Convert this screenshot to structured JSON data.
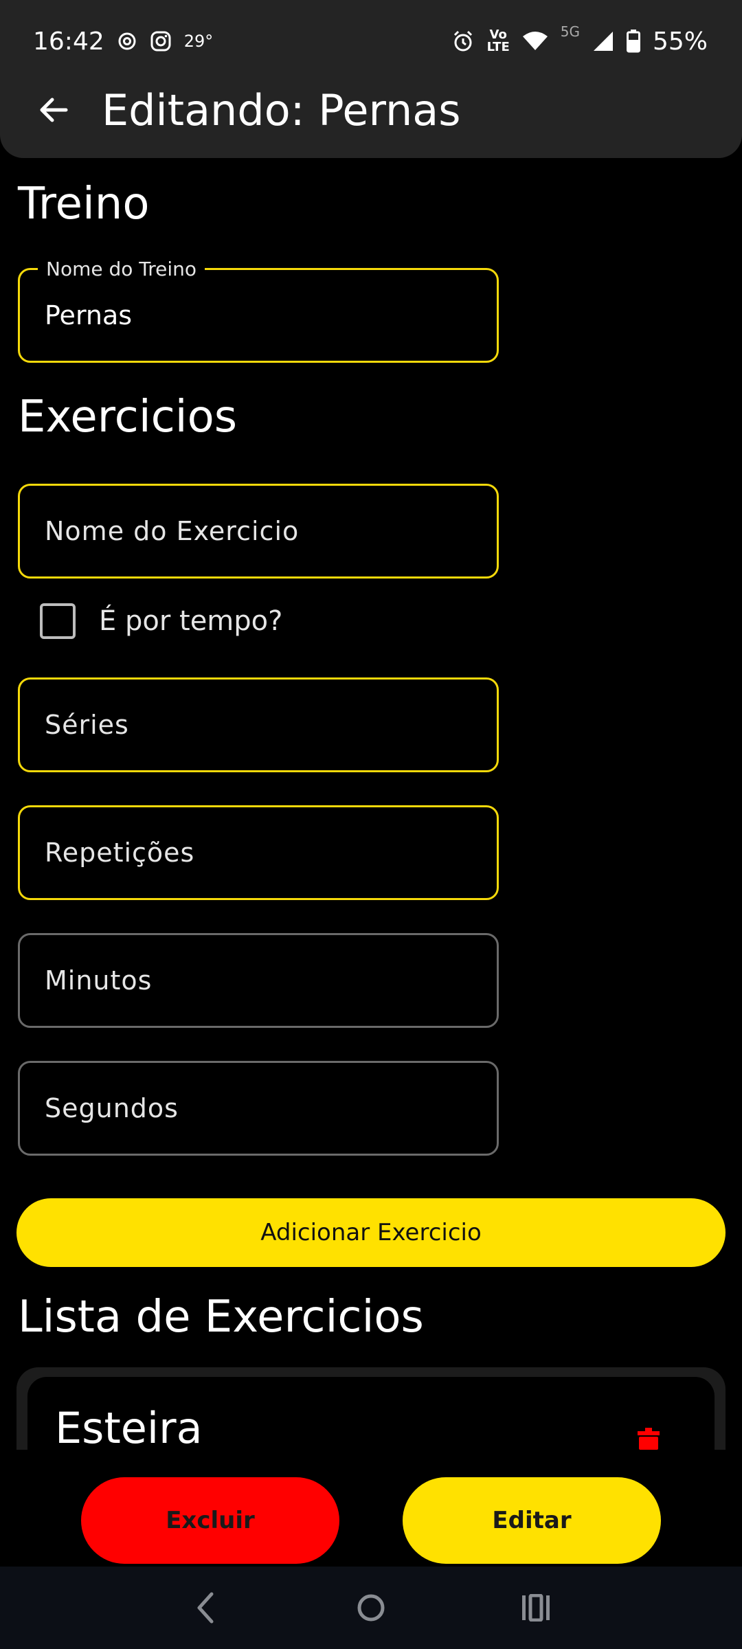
{
  "status_bar": {
    "time": "16:42",
    "temperature": "29°",
    "battery_percent": "55%",
    "volte_label_top": "Vo",
    "volte_label_bottom": "LTE",
    "network_label": "5G",
    "icons": [
      "camera-notification-icon",
      "instagram-icon",
      "alarm-icon",
      "volte-icon",
      "wifi-icon",
      "signal-icon",
      "battery-icon"
    ]
  },
  "toolbar": {
    "title": "Editando: Pernas",
    "back_icon": "arrow-left-icon"
  },
  "form": {
    "treino_section_title": "Treino",
    "workout_name_label": "Nome do Treino",
    "workout_name_value": "Pernas",
    "exercicios_section_title": "Exercicios",
    "exercise_name_placeholder": "Nome do Exercicio",
    "is_timed_label": "É por tempo?",
    "is_timed_checked": false,
    "series_placeholder": "Séries",
    "reps_placeholder": "Repetições",
    "minutes_placeholder": "Minutos",
    "seconds_placeholder": "Segundos",
    "add_button_label": "Adicionar Exercicio"
  },
  "exercise_list": {
    "title": "Lista de Exercicios",
    "items": [
      {
        "name": "Esteira",
        "delete_icon": "trash-icon"
      }
    ]
  },
  "actions": {
    "delete_label": "Excluir",
    "edit_label": "Editar"
  },
  "colors": {
    "accent_yellow": "#ffe100",
    "field_border_yellow": "#f5d90a",
    "danger_red": "#ff0000",
    "app_bar": "#242424",
    "background": "#000000"
  },
  "nav_bar": {
    "icons": [
      "nav-back-icon",
      "nav-home-icon",
      "nav-recents-icon"
    ]
  }
}
